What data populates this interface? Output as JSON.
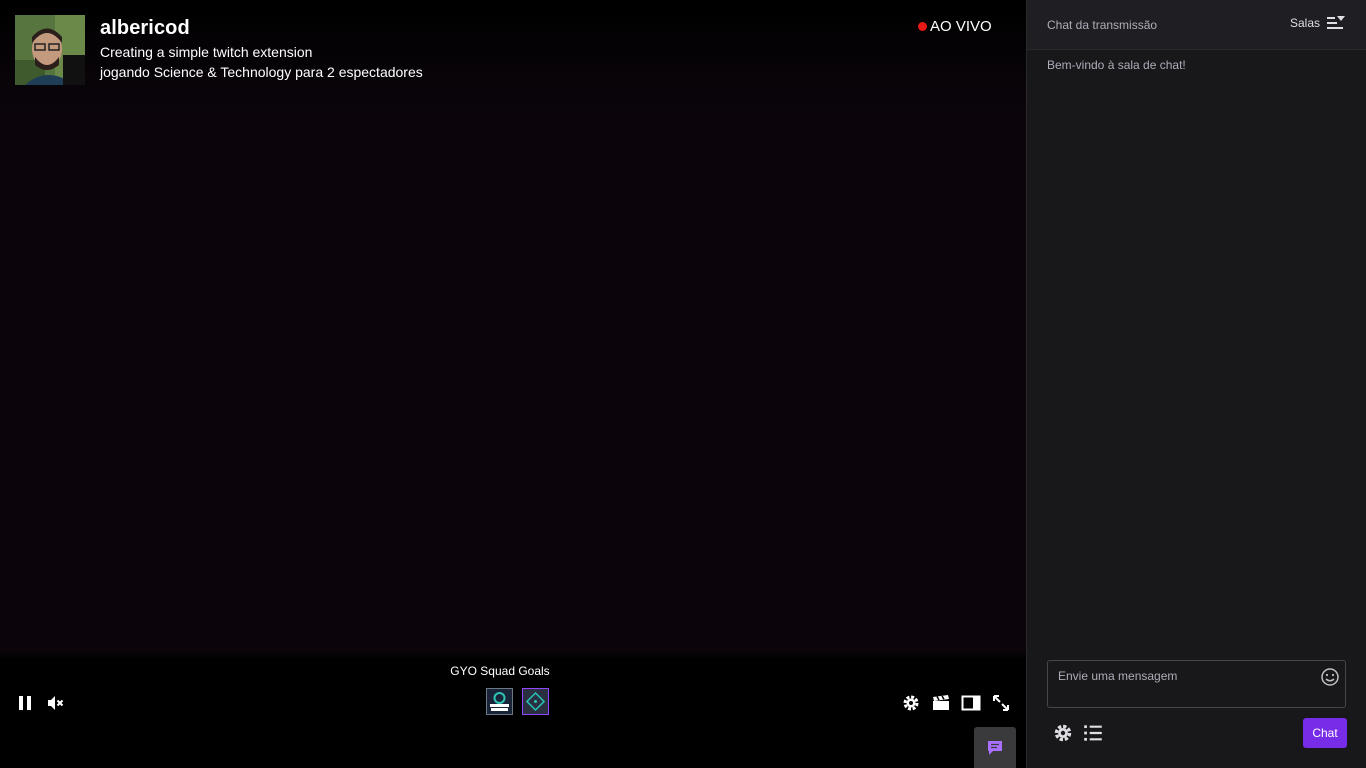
{
  "player": {
    "channel_name": "albericod",
    "stream_title": "Creating a simple twitch extension",
    "stream_game": "jogando Science & Technology para 2 espectadores",
    "live_label": "AO VIVO",
    "live_color": "#e91916",
    "extension_title": "GYO Squad Goals",
    "extension_icons": [
      "squad-goals-icon",
      "diamond-extension-icon"
    ],
    "controls": {
      "left": [
        "pause-icon",
        "muted-volume-icon"
      ],
      "right": [
        "gear-icon",
        "clip-icon",
        "theatre-mode-icon",
        "fullscreen-icon"
      ]
    },
    "chat_toggle_icon": "chat-bubble-icon"
  },
  "chat": {
    "title": "Chat da transmissão",
    "rooms_label": "Salas",
    "welcome": "Bem-vindo à sala de chat!",
    "input_placeholder": "Envie uma mensagem",
    "send_label": "Chat",
    "accent_color": "#772ce8"
  }
}
